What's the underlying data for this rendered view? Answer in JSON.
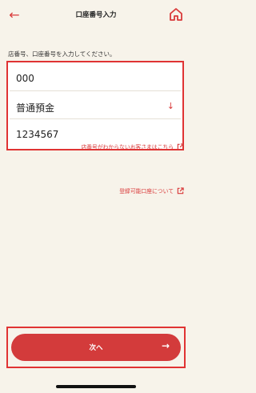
{
  "header": {
    "title": "口座番号入力",
    "back_icon": "arrow-left-icon",
    "home_icon": "home-icon"
  },
  "instruction": "店番号、口座番号を入力してください。",
  "form": {
    "branch_number": "000",
    "account_type": "普通預金",
    "account_number": "1234567"
  },
  "links": {
    "unknown_branch": "店番号がわからないお客さまはこちら",
    "registrable_accounts": "登録可能口座について"
  },
  "footer": {
    "next_label": "次へ"
  },
  "colors": {
    "accent": "#d33b3b",
    "highlight_border": "#e03333",
    "background": "#f7f3ea"
  }
}
